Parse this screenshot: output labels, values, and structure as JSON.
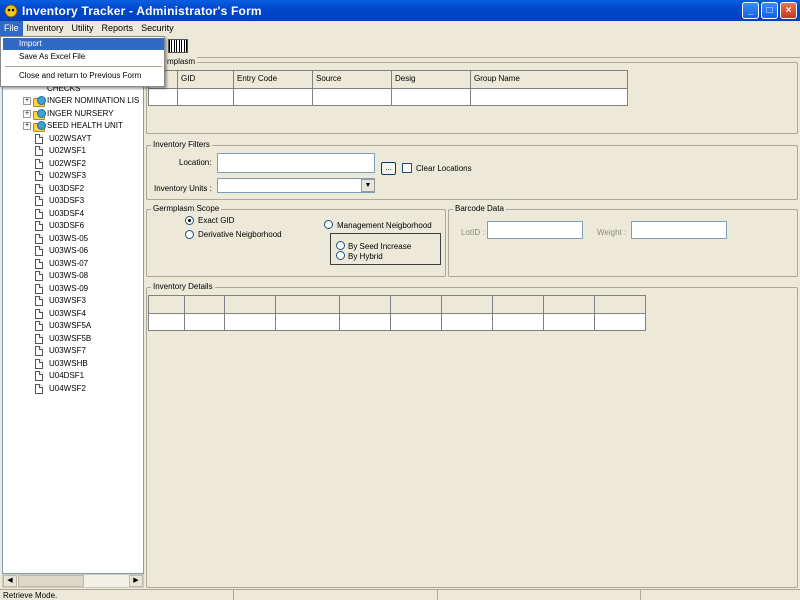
{
  "window": {
    "title": "Inventory Tracker - Administrator's Form",
    "minimize": "_",
    "maximize": "□",
    "close": "×"
  },
  "menu": [
    "File",
    "Inventory",
    "Utility",
    "Reports",
    "Security"
  ],
  "file_menu": {
    "import": "Import",
    "save_excel": "Save As Excel File",
    "close_return": "Close and return to Previous Form"
  },
  "tree": {
    "partial_top": "CHECKS",
    "folders": [
      "INGER NOMINATION LIS",
      "INGER NURSERY",
      "SEED HEALTH UNIT"
    ],
    "files": [
      "U02WSAYT",
      "U02WSF1",
      "U02WSF2",
      "U02WSF3",
      "U03DSF2",
      "U03DSF3",
      "U03DSF4",
      "U03DSF6",
      "U03WS-05",
      "U03WS-06",
      "U03WS-07",
      "U03WS-08",
      "U03WS-09",
      "U03WSF3",
      "U03WSF4",
      "U03WSF5A",
      "U03WSF5B",
      "U03WSF7",
      "U03WSHB",
      "U04DSF1",
      "U04WSF2"
    ]
  },
  "germplasm": {
    "title": "mplasm",
    "columns": [
      "GID",
      "Entry Code",
      "Source",
      "Desig",
      "Group Name"
    ]
  },
  "inventory_filters": {
    "title": "Inventory Filters",
    "location_label": "Location:",
    "browse_label": "...",
    "clear_locations": "Clear Locations",
    "units_label": "Inventory Units :",
    "arrow": "▼"
  },
  "germplasm_scope": {
    "title": "Germplasm Scope",
    "exact_gid": "Exact GID",
    "derivative": "Derivative Neigborhood",
    "management": "Management Neigborhood",
    "seed_increase": "By Seed Increase",
    "hybrid": "By Hybrid"
  },
  "barcode": {
    "title": "Barcode Data",
    "lotid_label": "LotID :",
    "weight_label": "Weight :"
  },
  "inventory_details": {
    "title": "Inventory Details"
  },
  "status": {
    "text": "Retrieve Mode."
  }
}
